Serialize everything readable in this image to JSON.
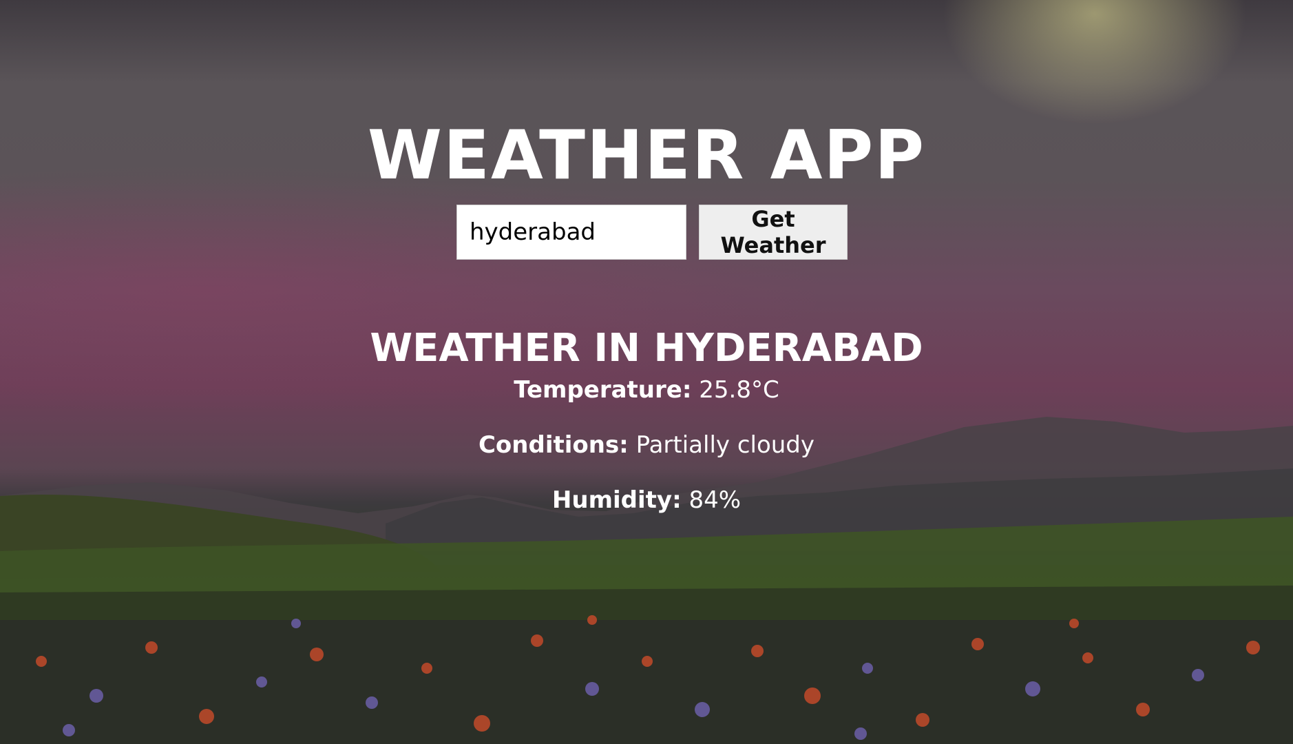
{
  "app": {
    "title": "Weather App"
  },
  "search": {
    "value": "hyderabad",
    "button_label": "Get Weather"
  },
  "result": {
    "heading": "Weather in Hyderabad",
    "temperature_label": "Temperature:",
    "temperature_value": "25.8°C",
    "conditions_label": "Conditions:",
    "conditions_value": "Partially cloudy",
    "humidity_label": "Humidity:",
    "humidity_value": "84%"
  },
  "colors": {
    "text": "#ffffff",
    "input_bg": "#ffffff",
    "button_bg": "#eeeeee"
  }
}
